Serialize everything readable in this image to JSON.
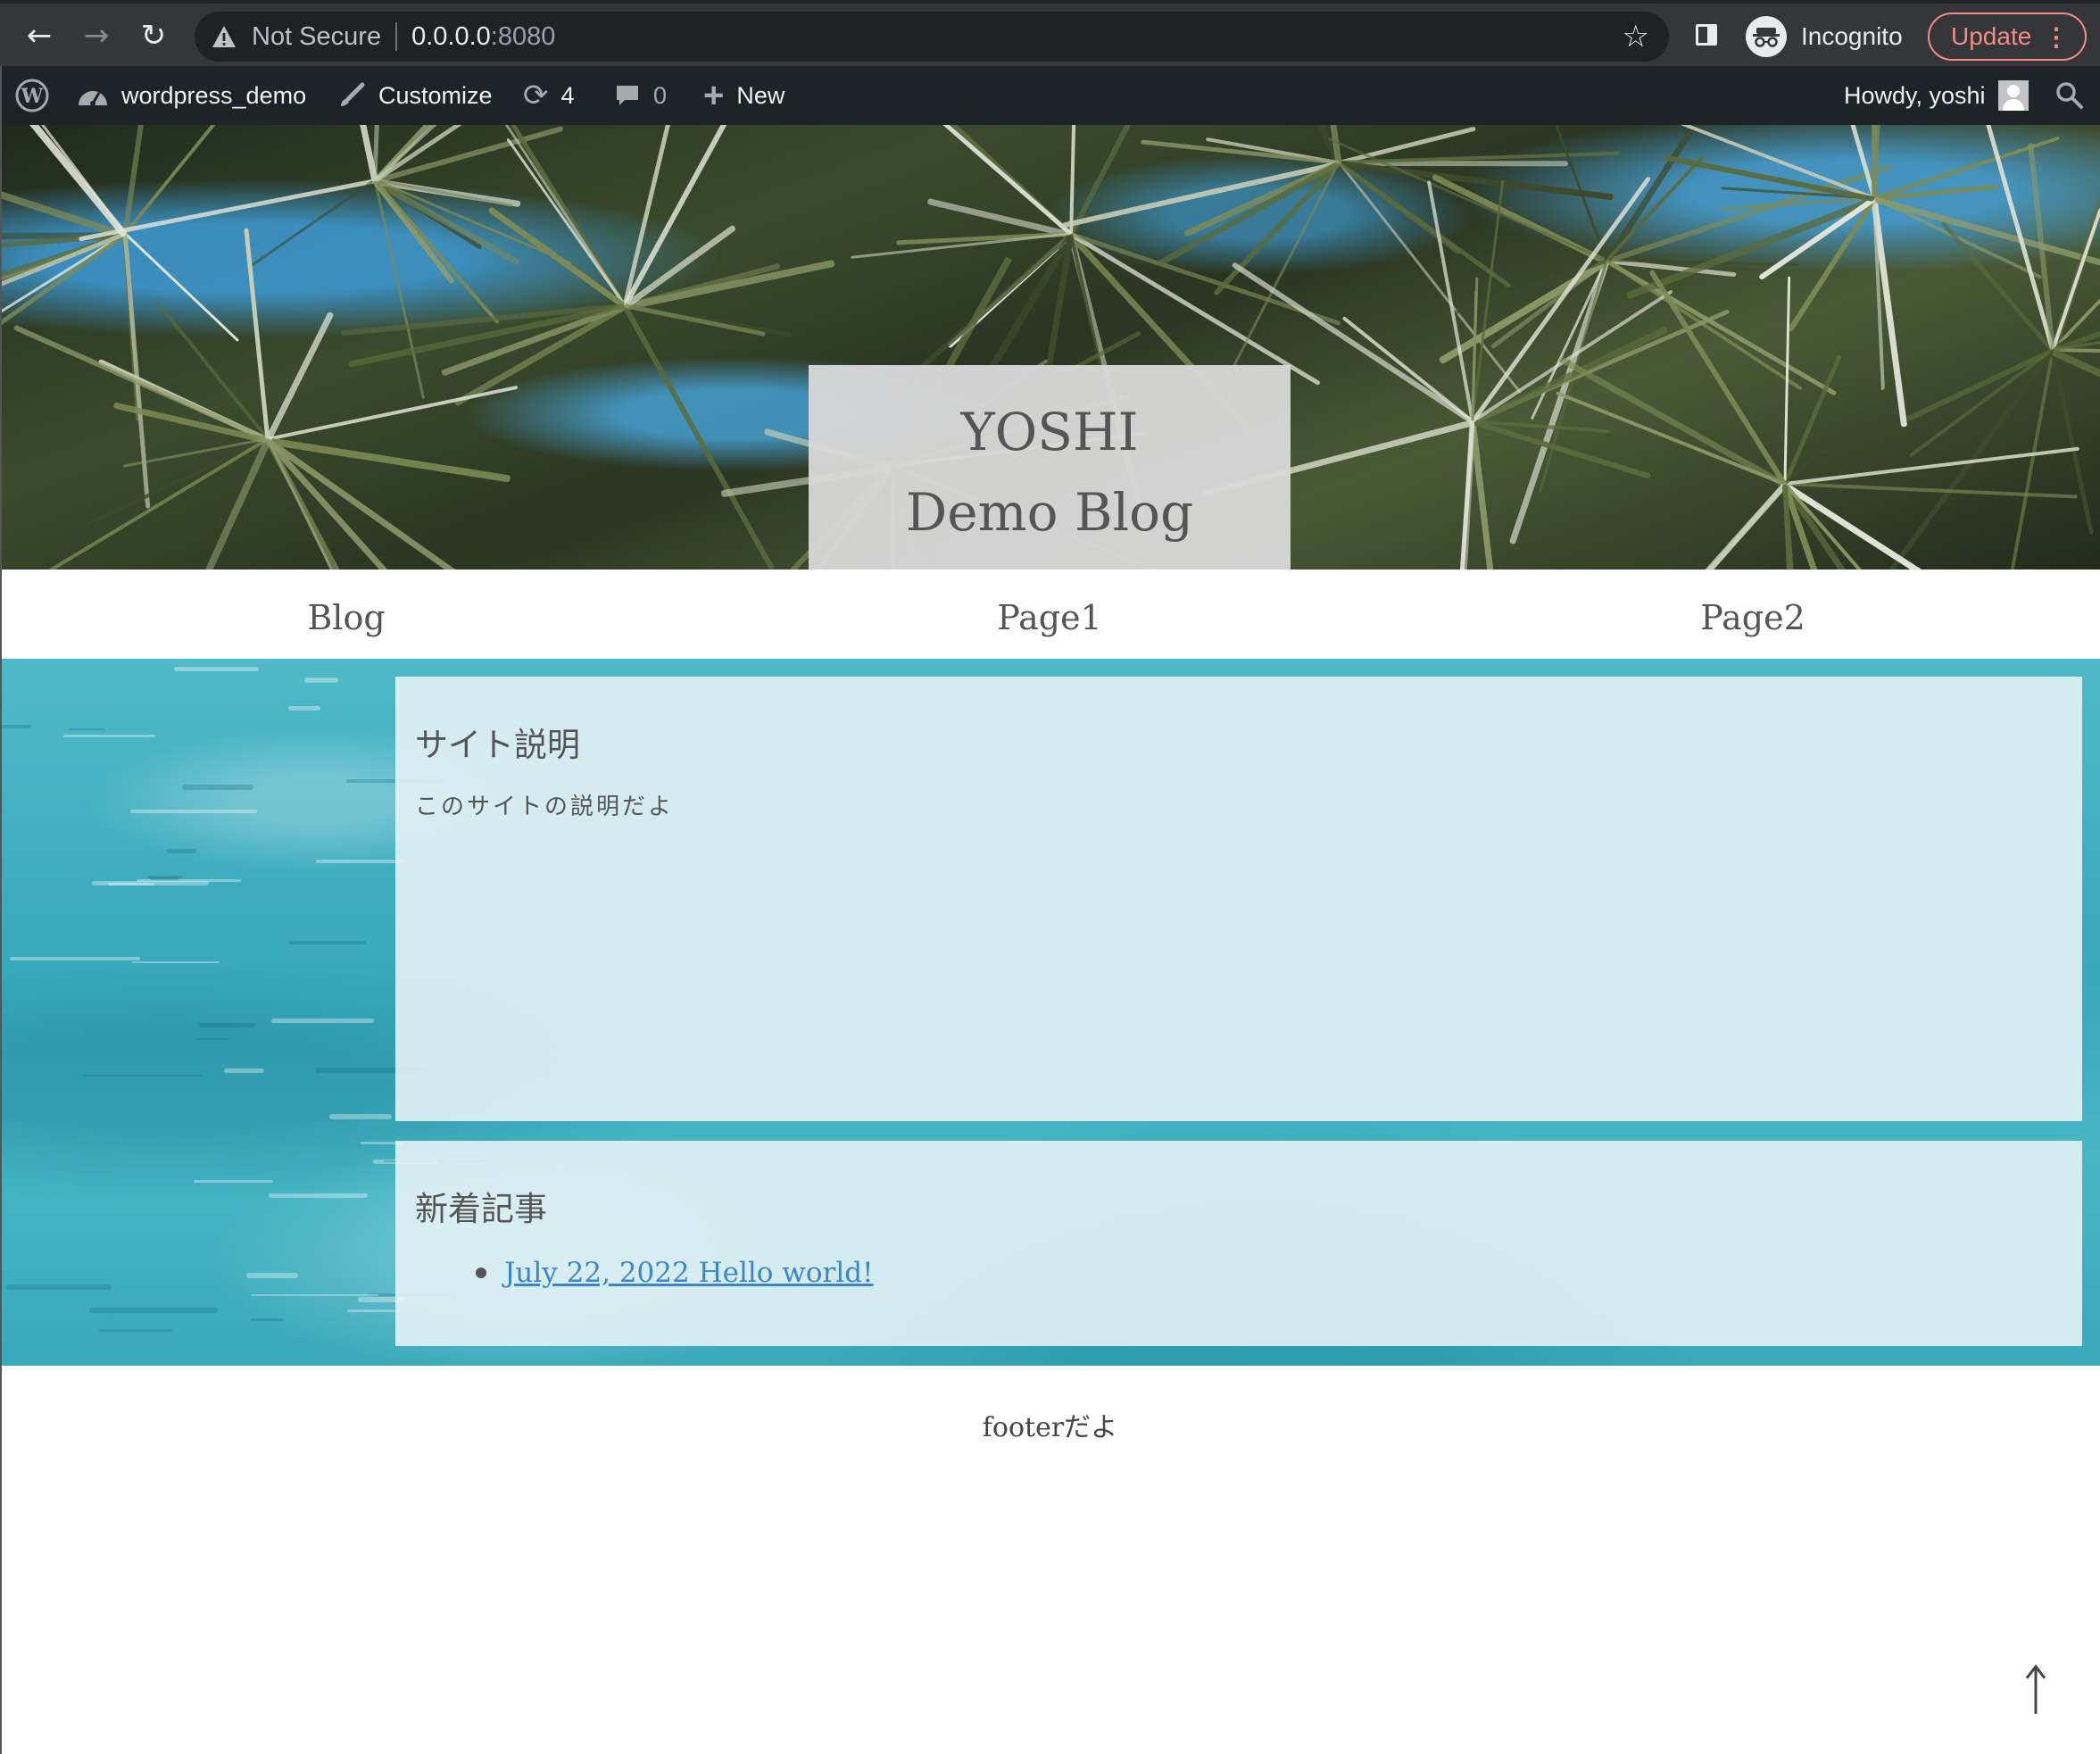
{
  "browser": {
    "security_label": "Not Secure",
    "url_host": "0.0.0.0",
    "url_port": ":8080",
    "profile_label": "Incognito",
    "update_label": "Update",
    "icons": [
      "back-icon",
      "forward-icon",
      "reload-icon",
      "warning-icon",
      "star-icon",
      "side-panel-icon",
      "incognito-icon",
      "kebab-menu-icon"
    ]
  },
  "admin_bar": {
    "site_name": "wordpress_demo",
    "customize_label": "Customize",
    "updates_count": "4",
    "comments_count": "0",
    "new_label": "New",
    "howdy_label": "Howdy, yoshi",
    "icons": [
      "wordpress-logo-icon",
      "dashboard-icon",
      "brush-icon",
      "refresh-icon",
      "comment-icon",
      "plus-icon",
      "search-icon"
    ]
  },
  "header": {
    "title_line1": "YOSHI",
    "title_line2": "Demo Blog"
  },
  "nav": {
    "items": [
      {
        "label": "Blog"
      },
      {
        "label": "Page1"
      },
      {
        "label": "Page2"
      }
    ]
  },
  "widgets": {
    "site_description": {
      "heading": "サイト説明",
      "text": "このサイトの説明だよ"
    },
    "recent_posts": {
      "heading": "新着記事",
      "items": [
        {
          "label": "July 22, 2022 Hello world!"
        }
      ]
    }
  },
  "footer": {
    "text": "footerだよ"
  },
  "colors": {
    "link": "#3b86c8",
    "admin_bar_bg": "#1d2327",
    "browser_bg": "#35363a",
    "update_accent": "#f28b82"
  }
}
